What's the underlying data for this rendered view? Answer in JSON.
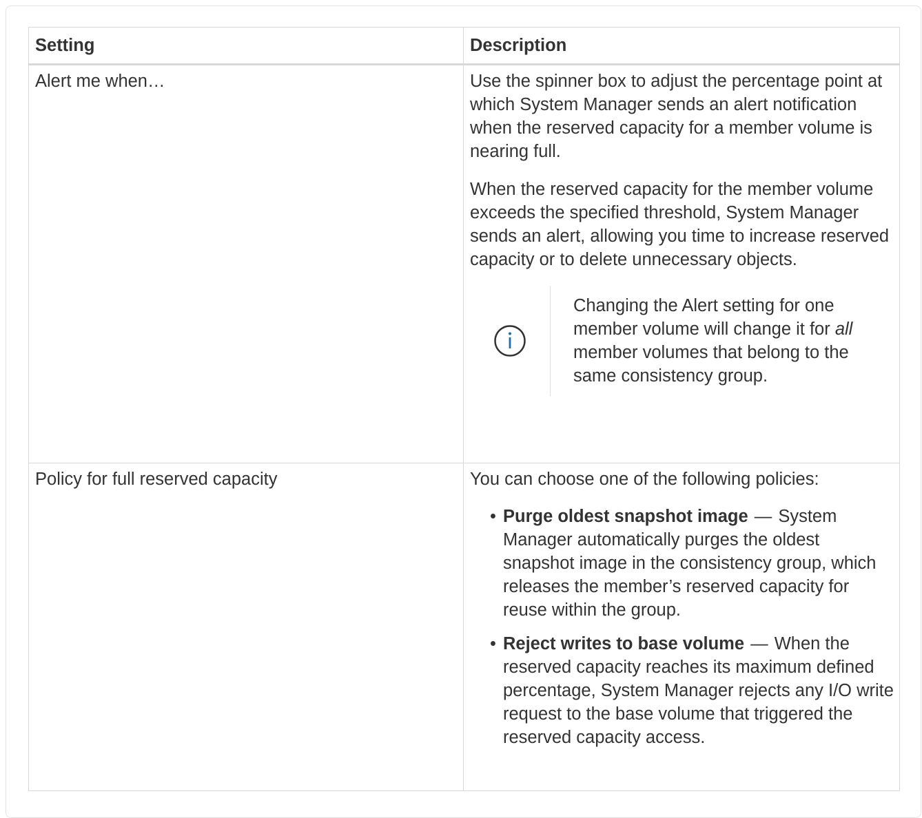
{
  "table": {
    "headers": {
      "setting": "Setting",
      "description": "Description"
    },
    "rows": [
      {
        "setting": "Alert me when…",
        "paragraphs": [
          "Use the spinner box to adjust the percentage point at which System Manager sends an alert notification when the reserved capacity for a member volume is nearing full.",
          "When the reserved capacity for the member volume exceeds the specified threshold, System Manager sends an alert, allowing you time to increase reserved capacity or to delete unnecessary objects."
        ],
        "note": {
          "icon": "info-circle-icon",
          "text_before": "Changing the Alert setting for one member volume will change it for ",
          "emphasis": "all",
          "text_after": " member volumes that belong to the same consistency group."
        }
      },
      {
        "setting": "Policy for full reserved capacity",
        "intro": "You can choose one of the following policies:",
        "items": [
          {
            "term": "Purge oldest snapshot image",
            "dash": "—",
            "text": "System Manager automatically purges the oldest snapshot image in the consistency group, which releases the member’s reserved capacity for reuse within the group."
          },
          {
            "term": "Reject writes to base volume",
            "dash": "—",
            "text": "When the reserved capacity reaches its maximum defined percentage, System Manager rejects any I/O write request to the base volume that triggered the reserved capacity access."
          }
        ],
        "bullet": "•"
      }
    ]
  },
  "colors": {
    "text": "#333333",
    "border": "#d8d8d8",
    "icon": "#1a6fb0"
  }
}
